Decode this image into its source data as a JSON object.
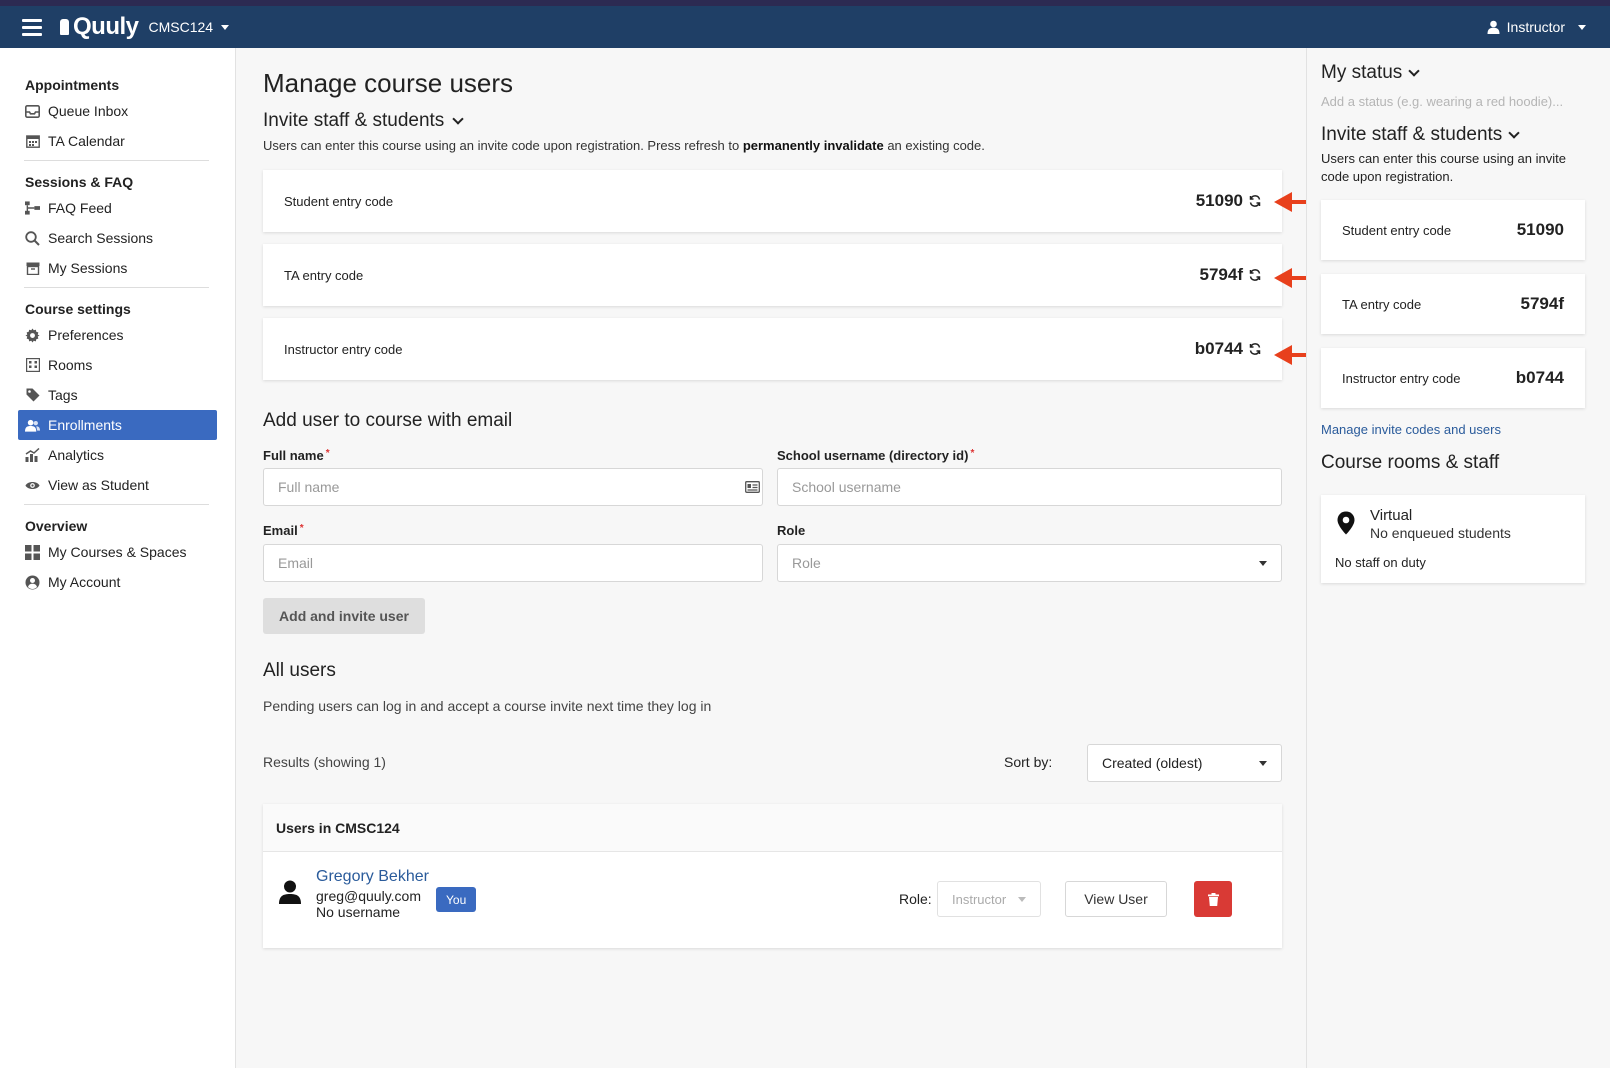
{
  "topbar": {
    "logo": "Quuly",
    "course": "CMSC124",
    "user_role": "Instructor"
  },
  "sidebar": {
    "sections": [
      {
        "header": "Appointments",
        "items": [
          {
            "label": "Queue Inbox",
            "icon": "inbox-icon"
          },
          {
            "label": "TA Calendar",
            "icon": "calendar-icon"
          }
        ]
      },
      {
        "header": "Sessions & FAQ",
        "items": [
          {
            "label": "FAQ Feed",
            "icon": "sitemap-icon"
          },
          {
            "label": "Search Sessions",
            "icon": "search-icon"
          },
          {
            "label": "My Sessions",
            "icon": "archive-icon"
          }
        ]
      },
      {
        "header": "Course settings",
        "items": [
          {
            "label": "Preferences",
            "icon": "gear-icon"
          },
          {
            "label": "Rooms",
            "icon": "building-icon"
          },
          {
            "label": "Tags",
            "icon": "tag-icon"
          },
          {
            "label": "Enrollments",
            "icon": "users-icon",
            "active": true
          },
          {
            "label": "Analytics",
            "icon": "chart-icon"
          },
          {
            "label": "View as Student",
            "icon": "eye-icon"
          }
        ]
      },
      {
        "header": "Overview",
        "items": [
          {
            "label": "My Courses & Spaces",
            "icon": "grid-icon"
          },
          {
            "label": "My Account",
            "icon": "user-circle-icon"
          }
        ]
      }
    ]
  },
  "main": {
    "title": "Manage course users",
    "invite": {
      "heading": "Invite staff & students",
      "help_pre": "Users can enter this course using an invite code upon registration. Press refresh to ",
      "help_bold": "permanently invalidate",
      "help_post": " an existing code.",
      "codes": [
        {
          "label": "Student entry code",
          "value": "51090"
        },
        {
          "label": "TA entry code",
          "value": "5794f"
        },
        {
          "label": "Instructor entry code",
          "value": "b0744"
        }
      ]
    },
    "add_user": {
      "heading": "Add user to course with email",
      "full_name_label": "Full name",
      "full_name_placeholder": "Full name",
      "username_label": "School username (directory id)",
      "username_placeholder": "School username",
      "email_label": "Email",
      "email_placeholder": "Email",
      "role_label": "Role",
      "role_placeholder": "Role",
      "submit_label": "Add and invite user",
      "required_mark": "*"
    },
    "all_users": {
      "heading": "All users",
      "help": "Pending users can log in and accept a course invite next time they log in",
      "results": "Results (showing 1)",
      "sort_label": "Sort by:",
      "sort_value": "Created (oldest)",
      "table_header": "Users in CMSC124",
      "users": [
        {
          "name": "Gregory Bekher",
          "email": "greg@quuly.com",
          "username": "No username",
          "badge": "You",
          "role_label": "Role:",
          "role": "Instructor",
          "view_label": "View User"
        }
      ]
    }
  },
  "right_panel": {
    "status_heading": "My status",
    "status_placeholder": "Add a status (e.g. wearing a red hoodie)...",
    "invite_heading": "Invite staff & students",
    "invite_help": "Users can enter this course using an invite code upon registration.",
    "codes": [
      {
        "label": "Student entry code",
        "value": "51090"
      },
      {
        "label": "TA entry code",
        "value": "5794f"
      },
      {
        "label": "Instructor entry code",
        "value": "b0744"
      }
    ],
    "manage_link": "Manage invite codes and users",
    "rooms_heading": "Course rooms & staff",
    "room": {
      "name": "Virtual",
      "queue": "No enqueued students",
      "staff": "No staff on duty"
    }
  },
  "colors": {
    "topbar": "#1f3f66",
    "accent": "#3a6ac0",
    "link": "#2a5b9b",
    "annotation_arrow": "#e8401c",
    "danger": "#d93a35"
  }
}
